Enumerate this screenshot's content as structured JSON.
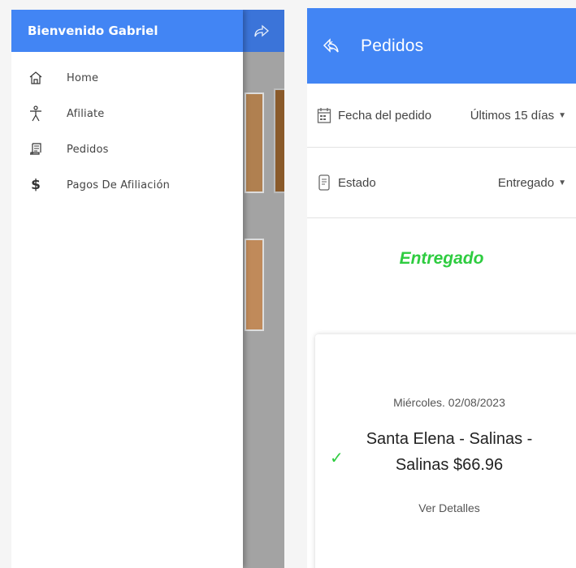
{
  "drawer": {
    "header_title": "Bienvenido Gabriel",
    "items": [
      {
        "label": "Home",
        "icon": "home-icon"
      },
      {
        "label": "Afiliate",
        "icon": "person-icon"
      },
      {
        "label": "Pedidos",
        "icon": "receipt-icon"
      },
      {
        "label": "Pagos De Afiliación",
        "icon": "dollar-icon"
      }
    ],
    "share_icon": "share-icon"
  },
  "orders": {
    "title": "Pedidos",
    "filters": [
      {
        "label": "Fecha del pedido",
        "value": "Últimos 15 días",
        "icon": "calendar-icon"
      },
      {
        "label": "Estado",
        "value": "Entregado",
        "icon": "document-icon"
      }
    ],
    "status_heading": "Entregado",
    "order": {
      "date": "Miércoles. 02/08/2023",
      "place": "Santa Elena - Salinas - Salinas $66.96",
      "details_link": "Ver Detalles"
    }
  },
  "colors": {
    "header_blue": "#4285f4",
    "status_green": "#2ecc40"
  }
}
